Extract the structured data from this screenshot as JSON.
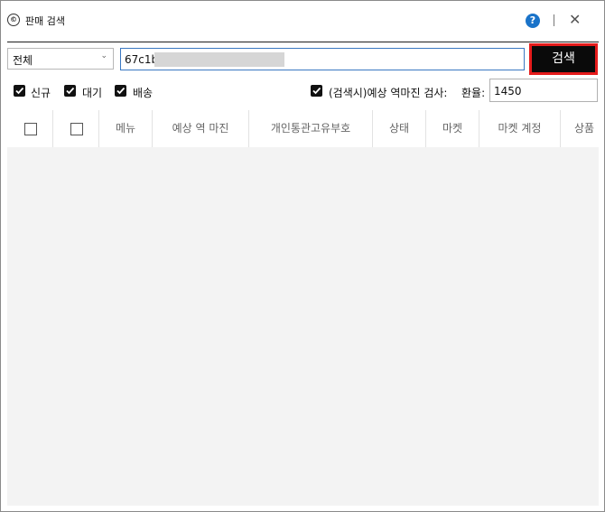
{
  "window": {
    "title": "판매 검색",
    "app_icon_glyph": "©"
  },
  "toolbar": {
    "category_select": {
      "value": "전체"
    },
    "search_input": {
      "value": "67c1b",
      "redacted": true
    },
    "search_button_label": "검색"
  },
  "filters": {
    "checkboxes": [
      {
        "label": "신규",
        "checked": true
      },
      {
        "label": "대기",
        "checked": true
      },
      {
        "label": "배송",
        "checked": true
      }
    ],
    "margin_check": {
      "label": "(검색시)예상 역마진 검사:",
      "checked": true
    },
    "exchange_rate": {
      "label": "환율:",
      "value": "1450"
    }
  },
  "table": {
    "columns": [
      "메뉴",
      "예상 역 마진",
      "개인통관고유부호",
      "상태",
      "마켓",
      "마켓 계정",
      "상품"
    ],
    "rows": []
  },
  "colors": {
    "accent_blue": "#1a73c9",
    "search_button_bg": "#0a0a0a",
    "search_button_border": "#e51b1b",
    "input_focus_border": "#3a78c2"
  }
}
